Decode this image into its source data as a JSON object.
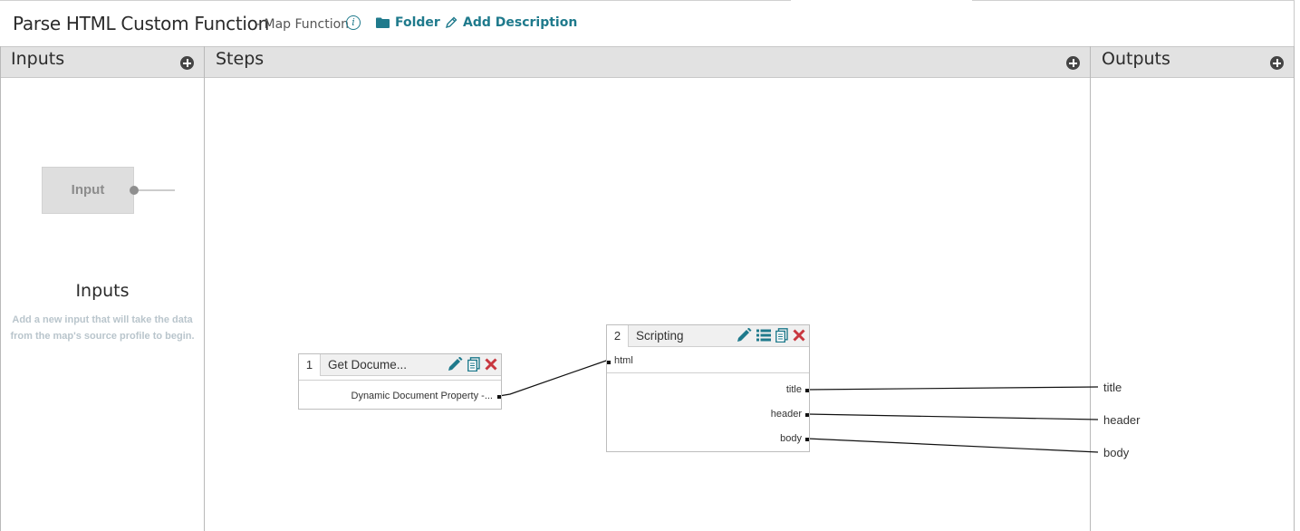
{
  "header": {
    "title": "Parse HTML Custom Function",
    "subtitle": "- Map Function",
    "info_icon": "info-icon",
    "folder_label": "Folder",
    "folder_icon": "folder-icon",
    "add_description_label": "Add Description",
    "add_description_icon": "pencil-icon"
  },
  "columns": {
    "inputs": {
      "label": "Inputs",
      "add_icon": "plus-circle-icon"
    },
    "steps": {
      "label": "Steps",
      "add_icon": "plus-circle-icon"
    },
    "outputs": {
      "label": "Outputs",
      "add_icon": "plus-circle-icon"
    }
  },
  "inputs_panel": {
    "placeholder_label": "Input",
    "heading": "Inputs",
    "help_text": "Add a new input that will take the data from the map's source profile to begin."
  },
  "steps": [
    {
      "number": "1",
      "name": "Get Docume...",
      "actions": [
        "edit-icon",
        "copy-icon",
        "delete-icon"
      ],
      "inputs": [],
      "outputs": [
        "Dynamic Document Property -..."
      ]
    },
    {
      "number": "2",
      "name": "Scripting",
      "actions": [
        "edit-icon",
        "list-icon",
        "copy-icon",
        "delete-icon"
      ],
      "inputs": [
        "html"
      ],
      "outputs": [
        "title",
        "header",
        "body"
      ]
    }
  ],
  "outputs": [
    "title",
    "header",
    "body"
  ],
  "colors": {
    "accent": "#1f7a8c",
    "delete": "#c8373f",
    "header_bg": "#e2e2e2",
    "help_text": "#b9c5cc"
  }
}
